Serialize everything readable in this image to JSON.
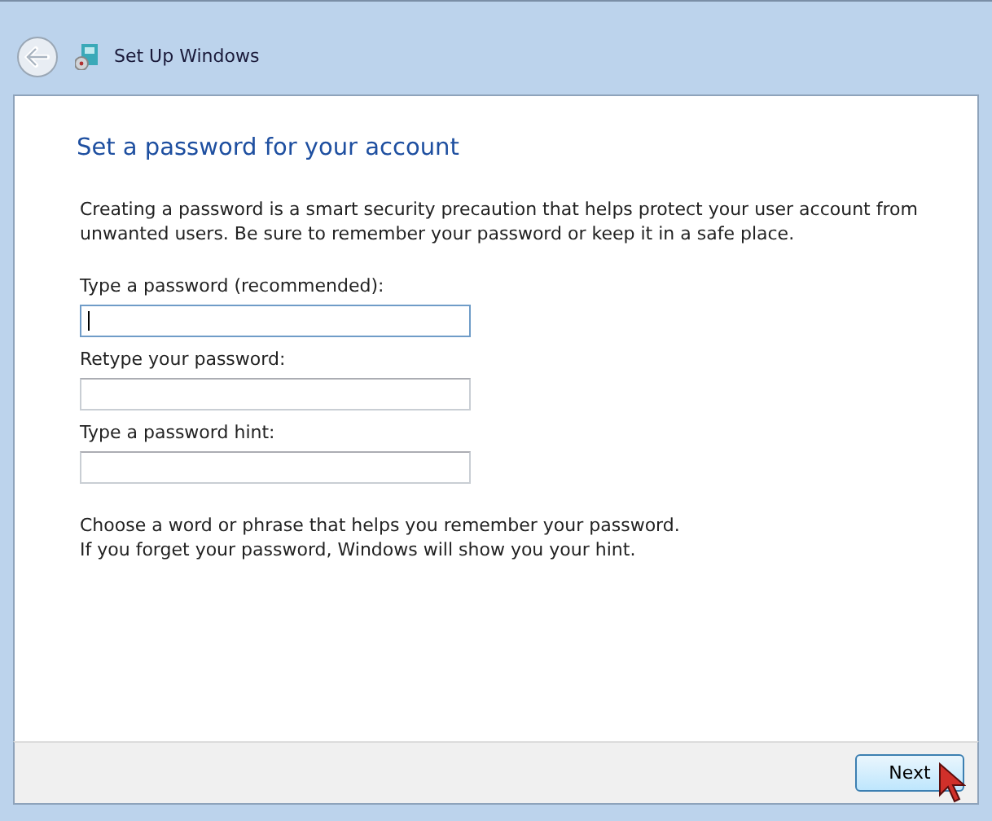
{
  "window": {
    "title": "Set Up Windows"
  },
  "heading": "Set a password for your account",
  "intro": "Creating a password is a smart security precaution that helps protect your user account from unwanted users. Be sure to remember your password or keep it in a safe place.",
  "fields": [
    {
      "label": "Type a password (recommended):",
      "focused": true
    },
    {
      "label": "Retype your password:",
      "focused": false
    },
    {
      "label": "Type a password hint:",
      "focused": false
    }
  ],
  "hint_lines": [
    "Choose a word or phrase that helps you remember your password.",
    "If you forget your password, Windows will show you your hint."
  ],
  "buttons": [
    {
      "label": "Next",
      "hovered": true
    }
  ]
}
